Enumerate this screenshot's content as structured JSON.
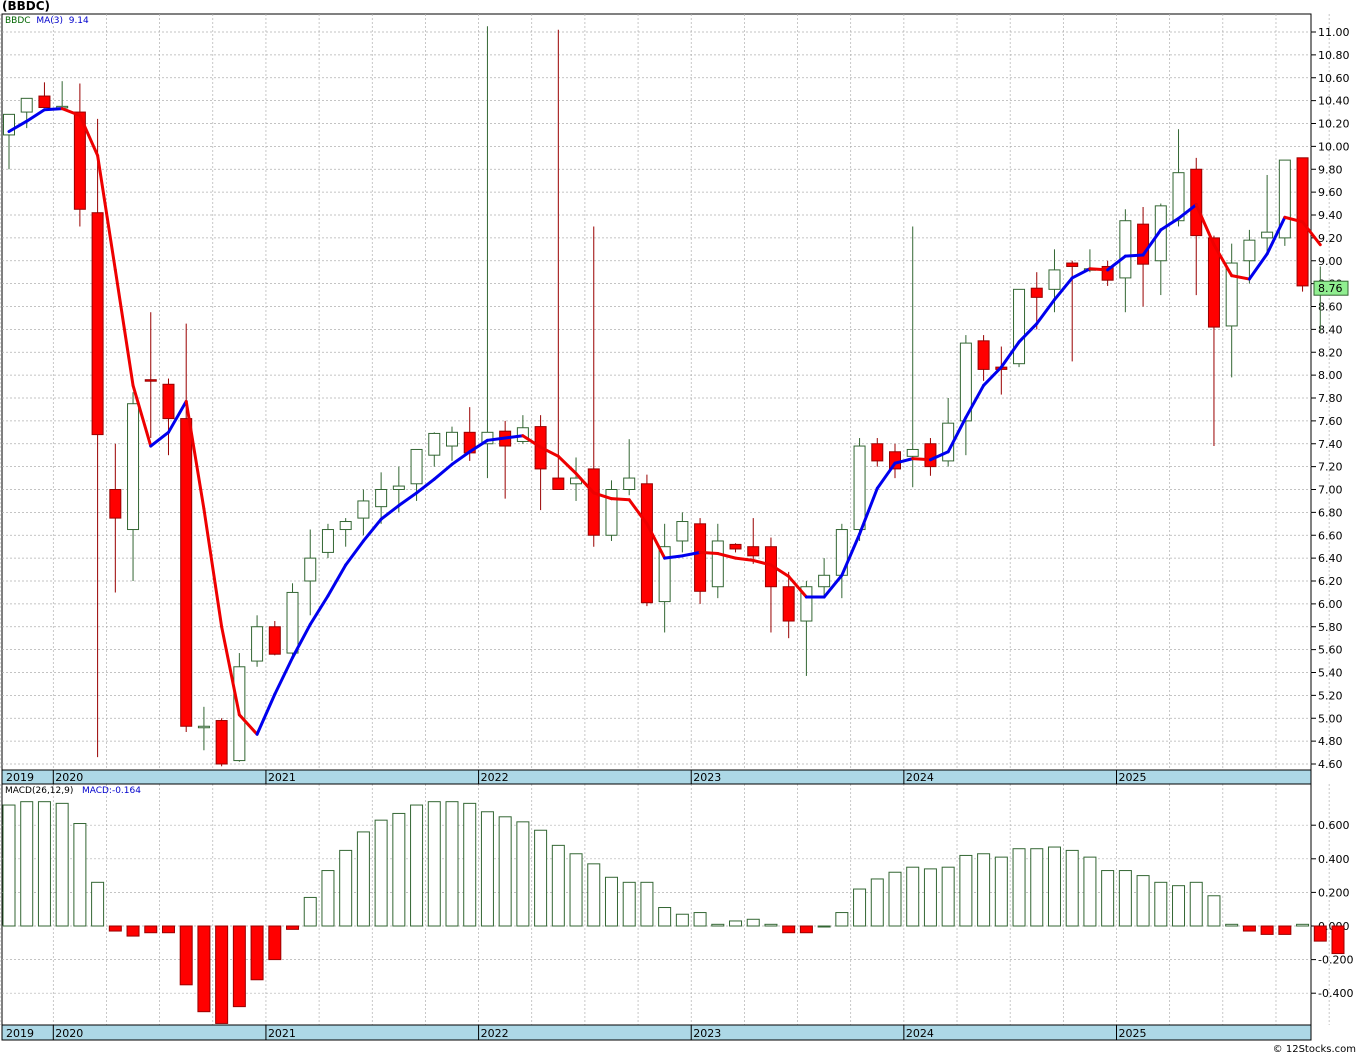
{
  "title": "(BBDC)",
  "credit": "© 12Stocks.com",
  "price_panel": {
    "symbol": "BBDC",
    "ma_label": "MA(3)",
    "ma_value": "9.14",
    "last_price": "8.76",
    "y_ticks": [
      "11.00",
      "10.80",
      "10.60",
      "10.40",
      "10.20",
      "10.00",
      "9.80",
      "9.60",
      "9.40",
      "9.20",
      "9.00",
      "8.80",
      "8.60",
      "8.40",
      "8.20",
      "8.00",
      "7.80",
      "7.60",
      "7.40",
      "7.20",
      "7.00",
      "6.80",
      "6.60",
      "6.40",
      "6.20",
      "6.00",
      "5.80",
      "5.60",
      "5.40",
      "5.20",
      "5.00",
      "4.80",
      "4.60"
    ]
  },
  "macd_panel": {
    "label": "MACD(26,12,9)",
    "value_label": "MACD:-0.164",
    "y_ticks": [
      "0.600",
      "0.400",
      "0.200",
      "0.000",
      "-0.200",
      "-0.400"
    ]
  },
  "year_labels": [
    "2019",
    "2020",
    "2021",
    "2022",
    "2023",
    "2024",
    "2025"
  ],
  "colors": {
    "up_body": "#ffffff",
    "up_outline": "#336633",
    "down_body": "#ff0000",
    "down_outline": "#990000",
    "ma_up": "#0000ee",
    "ma_down": "#ee0000",
    "axis_band": "#add8e6",
    "grid": "#b0b0b0",
    "last_price_box": "#90ee90"
  },
  "chart_data": [
    {
      "type": "candlestick",
      "title": "(BBDC)",
      "interval": "monthly",
      "ylim": [
        4.55,
        11.2
      ],
      "grid": true,
      "ohlc": [
        [
          10.1,
          10.28,
          9.8,
          10.28
        ],
        [
          10.3,
          10.42,
          10.16,
          10.42
        ],
        [
          10.44,
          10.56,
          10.34,
          10.34
        ],
        [
          10.35,
          10.57,
          10.34,
          10.35
        ],
        [
          10.3,
          10.55,
          9.3,
          9.45
        ],
        [
          9.42,
          10.24,
          4.66,
          7.48
        ],
        [
          7.0,
          7.4,
          6.1,
          6.75
        ],
        [
          6.65,
          7.85,
          6.2,
          7.75
        ],
        [
          7.96,
          8.55,
          7.45,
          7.95
        ],
        [
          7.92,
          7.97,
          7.3,
          7.62
        ],
        [
          7.62,
          8.45,
          4.88,
          4.93
        ],
        [
          4.93,
          5.1,
          4.72,
          4.93
        ],
        [
          4.98,
          5.0,
          4.58,
          4.6
        ],
        [
          4.63,
          5.57,
          4.62,
          5.45
        ],
        [
          5.5,
          5.9,
          5.45,
          5.8
        ],
        [
          5.8,
          5.85,
          5.55,
          5.56
        ],
        [
          5.57,
          6.18,
          5.55,
          6.1
        ],
        [
          6.2,
          6.65,
          5.9,
          6.4
        ],
        [
          6.45,
          6.7,
          6.4,
          6.65
        ],
        [
          6.65,
          6.75,
          6.5,
          6.72
        ],
        [
          6.75,
          7.0,
          6.6,
          6.9
        ],
        [
          6.85,
          7.15,
          6.7,
          7.0
        ],
        [
          7.0,
          7.2,
          6.8,
          7.03
        ],
        [
          7.05,
          7.3,
          6.9,
          7.35
        ],
        [
          7.3,
          7.5,
          7.2,
          7.49
        ],
        [
          7.38,
          7.55,
          7.25,
          7.5
        ],
        [
          7.5,
          7.72,
          7.25,
          7.32
        ],
        [
          7.4,
          11.05,
          7.1,
          7.5
        ],
        [
          7.51,
          7.6,
          6.92,
          7.38
        ],
        [
          7.42,
          7.65,
          7.4,
          7.54
        ],
        [
          7.55,
          7.65,
          6.82,
          7.18
        ],
        [
          7.1,
          11.02,
          7.05,
          7.0
        ],
        [
          7.05,
          7.28,
          6.9,
          7.1
        ],
        [
          7.18,
          9.3,
          6.5,
          6.6
        ],
        [
          6.6,
          7.08,
          6.55,
          7.0
        ],
        [
          7.0,
          7.44,
          6.95,
          7.1
        ],
        [
          7.05,
          7.13,
          5.98,
          6.01
        ],
        [
          6.02,
          6.7,
          5.75,
          6.5
        ],
        [
          6.55,
          6.8,
          6.45,
          6.72
        ],
        [
          6.7,
          6.75,
          6.0,
          6.11
        ],
        [
          6.15,
          6.7,
          6.05,
          6.55
        ],
        [
          6.52,
          6.53,
          6.45,
          6.48
        ],
        [
          6.5,
          6.75,
          6.35,
          6.42
        ],
        [
          6.5,
          6.58,
          5.75,
          6.15
        ],
        [
          6.15,
          6.28,
          5.7,
          5.85
        ],
        [
          5.85,
          6.2,
          5.37,
          6.15
        ],
        [
          6.15,
          6.4,
          6.05,
          6.25
        ],
        [
          6.25,
          6.7,
          6.05,
          6.65
        ],
        [
          6.65,
          7.45,
          6.55,
          7.38
        ],
        [
          7.4,
          7.45,
          7.2,
          7.25
        ],
        [
          7.33,
          7.4,
          7.1,
          7.18
        ],
        [
          7.29,
          9.3,
          7.02,
          7.35
        ],
        [
          7.4,
          7.45,
          7.12,
          7.2
        ],
        [
          7.25,
          7.8,
          7.2,
          7.58
        ],
        [
          7.6,
          8.35,
          7.3,
          8.28
        ],
        [
          8.3,
          8.35,
          7.95,
          8.05
        ],
        [
          8.07,
          8.25,
          7.83,
          8.05
        ],
        [
          8.1,
          8.75,
          8.07,
          8.75
        ],
        [
          8.76,
          8.9,
          8.4,
          8.68
        ],
        [
          8.75,
          9.1,
          8.55,
          8.92
        ],
        [
          8.98,
          9.0,
          8.12,
          8.95
        ],
        [
          8.93,
          9.1,
          8.9,
          8.93
        ],
        [
          8.95,
          9.0,
          8.78,
          8.83
        ],
        [
          8.85,
          9.45,
          8.55,
          9.35
        ],
        [
          9.32,
          9.47,
          8.6,
          8.97
        ],
        [
          9.0,
          9.5,
          8.7,
          9.48
        ],
        [
          9.35,
          10.15,
          9.3,
          9.77
        ],
        [
          9.8,
          9.9,
          8.7,
          9.22
        ],
        [
          9.2,
          9.22,
          7.38,
          8.42
        ],
        [
          8.43,
          9.15,
          7.98,
          8.98
        ],
        [
          9.0,
          9.27,
          8.8,
          9.18
        ],
        [
          9.2,
          9.75,
          9.05,
          9.25
        ],
        [
          9.2,
          9.88,
          9.13,
          9.88
        ],
        [
          9.9,
          9.9,
          8.73,
          8.78
        ],
        [
          8.72,
          8.95,
          8.38,
          8.76
        ]
      ],
      "ma3": [
        10.13,
        10.22,
        10.32,
        10.33,
        10.27,
        9.92,
        8.92,
        7.91,
        7.38,
        7.5,
        7.77,
        6.83,
        5.8,
        5.03,
        4.86,
        5.21,
        5.53,
        5.82,
        6.07,
        6.34,
        6.55,
        6.74,
        6.86,
        6.97,
        7.09,
        7.22,
        7.33,
        7.43,
        7.45,
        7.47,
        7.37,
        7.29,
        7.14,
        6.97,
        6.92,
        6.91,
        6.7,
        6.4,
        6.42,
        6.45,
        6.44,
        6.4,
        6.38,
        6.34,
        6.24,
        6.06,
        6.06,
        6.25,
        6.61,
        7.01,
        7.23,
        7.27,
        7.26,
        7.33,
        7.63,
        7.91,
        8.07,
        8.29,
        8.45,
        8.66,
        8.85,
        8.93,
        8.92,
        9.04,
        9.05,
        9.27,
        9.37,
        9.49,
        9.14,
        8.87,
        8.84,
        9.06,
        9.38,
        9.34,
        9.14
      ]
    },
    {
      "type": "bar",
      "title": "MACD(26,12,9)",
      "ylim": [
        -0.6,
        0.8
      ],
      "grid": true,
      "values": [
        0.72,
        0.74,
        0.74,
        0.73,
        0.61,
        0.26,
        -0.03,
        -0.06,
        -0.04,
        -0.04,
        -0.35,
        -0.51,
        -0.58,
        -0.48,
        -0.32,
        -0.2,
        -0.02,
        0.17,
        0.33,
        0.45,
        0.56,
        0.63,
        0.67,
        0.72,
        0.74,
        0.74,
        0.73,
        0.68,
        0.65,
        0.62,
        0.57,
        0.48,
        0.43,
        0.37,
        0.29,
        0.26,
        0.26,
        0.11,
        0.07,
        0.08,
        0.01,
        0.03,
        0.04,
        0.01,
        -0.04,
        -0.04,
        0.0,
        0.08,
        0.22,
        0.28,
        0.32,
        0.35,
        0.34,
        0.35,
        0.42,
        0.43,
        0.41,
        0.46,
        0.46,
        0.47,
        0.45,
        0.41,
        0.33,
        0.33,
        0.3,
        0.26,
        0.24,
        0.26,
        0.18,
        0.01,
        -0.03,
        -0.05,
        -0.05,
        0.01,
        -0.09,
        -0.164
      ]
    }
  ]
}
